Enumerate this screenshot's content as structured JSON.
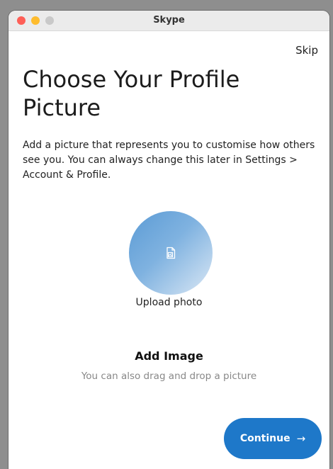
{
  "window": {
    "title": "Skype",
    "controls": [
      "close",
      "minimize",
      "maximize"
    ]
  },
  "header": {
    "skip_label": "Skip"
  },
  "main": {
    "heading": "Choose Your Profile Picture",
    "description": "Add a picture that represents you to customise how others see you. You can always change this later in Settings > Account & Profile.",
    "upload_label": "Upload photo",
    "upload_icon": "image-file-icon",
    "add_image_title": "Add Image",
    "add_image_subtitle": "You can also drag and drop a picture"
  },
  "footer": {
    "continue_label": "Continue",
    "continue_arrow": "→"
  },
  "colors": {
    "accent": "#1e78c9",
    "avatar_gradient_start": "#5b9bd5",
    "avatar_gradient_end": "#dbe8f5"
  }
}
